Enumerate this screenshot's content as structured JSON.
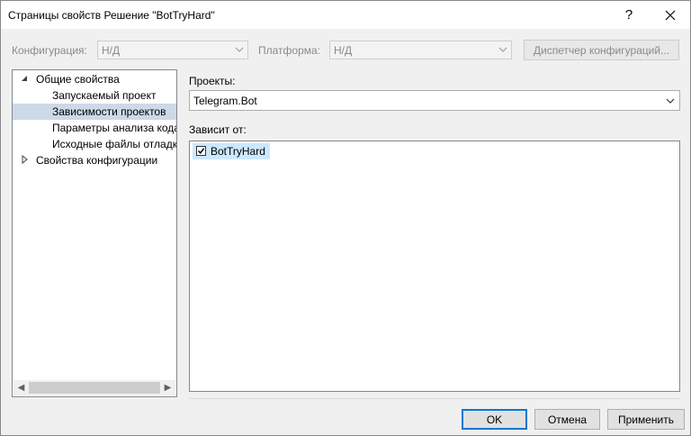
{
  "window": {
    "title": "Страницы свойств Решение \"BotTryHard\"",
    "help_label": "?",
    "close_label": "✕"
  },
  "toolbar": {
    "config_label": "Конфигурация:",
    "config_value": "Н/Д",
    "platform_label": "Платформа:",
    "platform_value": "Н/Д",
    "config_manager_label": "Диспетчер конфигураций..."
  },
  "tree": {
    "items": [
      {
        "label": "Общие свойства",
        "expander": "expanded"
      },
      {
        "label": "Запускаемый проект"
      },
      {
        "label": "Зависимости проектов",
        "selected": true
      },
      {
        "label": "Параметры анализа кода"
      },
      {
        "label": "Исходные файлы отладки"
      },
      {
        "label": "Свойства конфигурации",
        "expander": "collapsed"
      }
    ]
  },
  "main": {
    "projects_label": "Проекты:",
    "projects_value": "Telegram.Bot",
    "depends_label": "Зависит от:",
    "depends_items": [
      {
        "label": "BotTryHard",
        "checked": true
      }
    ]
  },
  "buttons": {
    "ok": "OK",
    "cancel": "Отмена",
    "apply": "Применить"
  },
  "colors": {
    "accent": "#0078d7",
    "selection": "#ccd9e8",
    "item_highlight": "#cce8ff"
  }
}
